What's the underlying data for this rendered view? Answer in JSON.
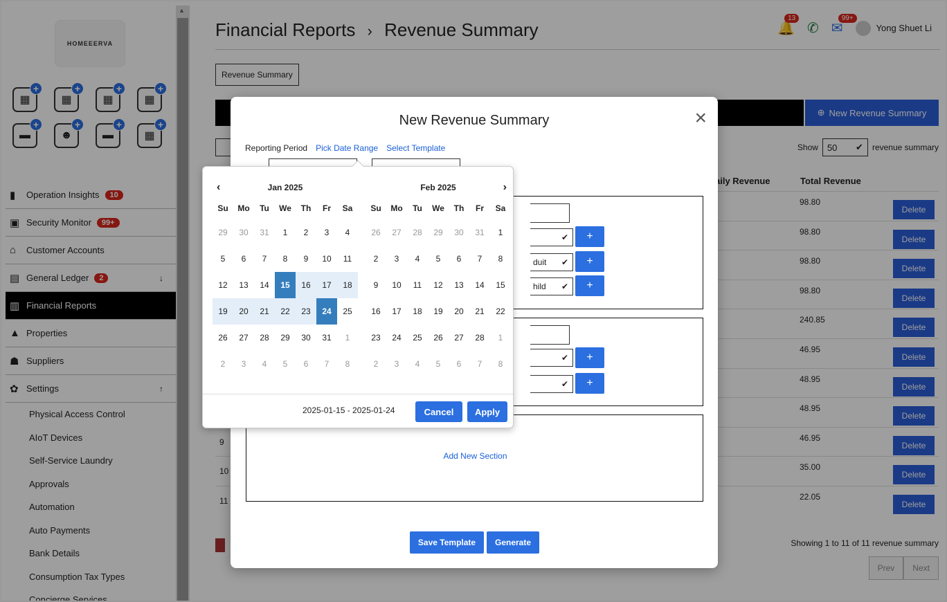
{
  "logo": {
    "text": "HOMEEERVA"
  },
  "sidebar": {
    "nav": [
      {
        "label": "Operation Insights",
        "icon": "chart-icon",
        "badge": "10"
      },
      {
        "label": "Security Monitor",
        "icon": "camera-icon",
        "badge": "99+"
      },
      {
        "label": "Customer Accounts",
        "icon": "house-icon"
      },
      {
        "label": "General Ledger",
        "icon": "ledger-icon",
        "badge": "2",
        "arrow": "↓"
      },
      {
        "label": "Financial Reports",
        "icon": "report-icon",
        "active": true
      },
      {
        "label": "Properties",
        "icon": "building-icon"
      },
      {
        "label": "Suppliers",
        "icon": "supplier-icon"
      },
      {
        "label": "Settings",
        "icon": "gear-icon",
        "arrow": "↑"
      }
    ],
    "settings_sub": [
      "Physical Access Control",
      "AIoT Devices",
      "Self-Service Laundry",
      "Approvals",
      "Automation",
      "Auto Payments",
      "Bank Details",
      "Consumption Tax Types",
      "Concierge Services"
    ]
  },
  "header": {
    "breadcrumb_parent": "Financial Reports",
    "breadcrumb_sep": "›",
    "breadcrumb_current": "Revenue Summary",
    "bell_badge": "13",
    "chat_badge": "99+",
    "user_name": "Yong Shuet Li"
  },
  "main": {
    "tab_label": "Revenue Summary",
    "new_button": "New Revenue Summary",
    "show_label": "Show",
    "show_value": "50",
    "show_suffix": "revenue summary",
    "col_daily": "aily Revenue",
    "col_total": "Total Revenue",
    "delete_label": "Delete",
    "rows": [
      {
        "num": "",
        "total": "98.80"
      },
      {
        "num": "",
        "total": "98.80"
      },
      {
        "num": "",
        "total": "98.80"
      },
      {
        "num": "",
        "total": "98.80"
      },
      {
        "num": "",
        "total": "240.85"
      },
      {
        "num": "",
        "total": "46.95"
      },
      {
        "num": "",
        "total": "48.95"
      },
      {
        "num": "",
        "total": "48.95"
      },
      {
        "num": "9",
        "total": "46.95"
      },
      {
        "num": "10",
        "total": "35.00"
      },
      {
        "num": "11",
        "total": "22.05"
      }
    ],
    "showing": "Showing 1 to 11 of 11 revenue summary",
    "prev": "Prev",
    "next": "Next"
  },
  "modal": {
    "title": "New Revenue Summary",
    "close": "×",
    "reporting_period": "Reporting Period",
    "pick_date_range": "Pick Date Range",
    "select_template": "Select Template",
    "sel_adult": "duit",
    "sel_child": "hild",
    "plus": "+",
    "add_new_section": "Add New Section",
    "save_template": "Save Template",
    "generate": "Generate"
  },
  "datepicker": {
    "left_month": "Jan 2025",
    "right_month": "Feb 2025",
    "prev": "‹",
    "next": "›",
    "dow": [
      "Su",
      "Mo",
      "Tu",
      "We",
      "Th",
      "Fr",
      "Sa"
    ],
    "left_days": [
      [
        "29",
        "30",
        "31",
        "1",
        "2",
        "3",
        "4"
      ],
      [
        "5",
        "6",
        "7",
        "8",
        "9",
        "10",
        "11"
      ],
      [
        "12",
        "13",
        "14",
        "15",
        "16",
        "17",
        "18"
      ],
      [
        "19",
        "20",
        "21",
        "22",
        "23",
        "24",
        "25"
      ],
      [
        "26",
        "27",
        "28",
        "29",
        "30",
        "31",
        "1"
      ],
      [
        "2",
        "3",
        "4",
        "5",
        "6",
        "7",
        "8"
      ]
    ],
    "right_days": [
      [
        "26",
        "27",
        "28",
        "29",
        "30",
        "31",
        "1"
      ],
      [
        "2",
        "3",
        "4",
        "5",
        "6",
        "7",
        "8"
      ],
      [
        "9",
        "10",
        "11",
        "12",
        "13",
        "14",
        "15"
      ],
      [
        "16",
        "17",
        "18",
        "19",
        "20",
        "21",
        "22"
      ],
      [
        "23",
        "24",
        "25",
        "26",
        "27",
        "28",
        "1"
      ],
      [
        "2",
        "3",
        "4",
        "5",
        "6",
        "7",
        "8"
      ]
    ],
    "range_text": "2025-01-15 - 2025-01-24",
    "cancel": "Cancel",
    "apply": "Apply",
    "accent": "#357ebd",
    "range_bg": "#e3eef9"
  }
}
